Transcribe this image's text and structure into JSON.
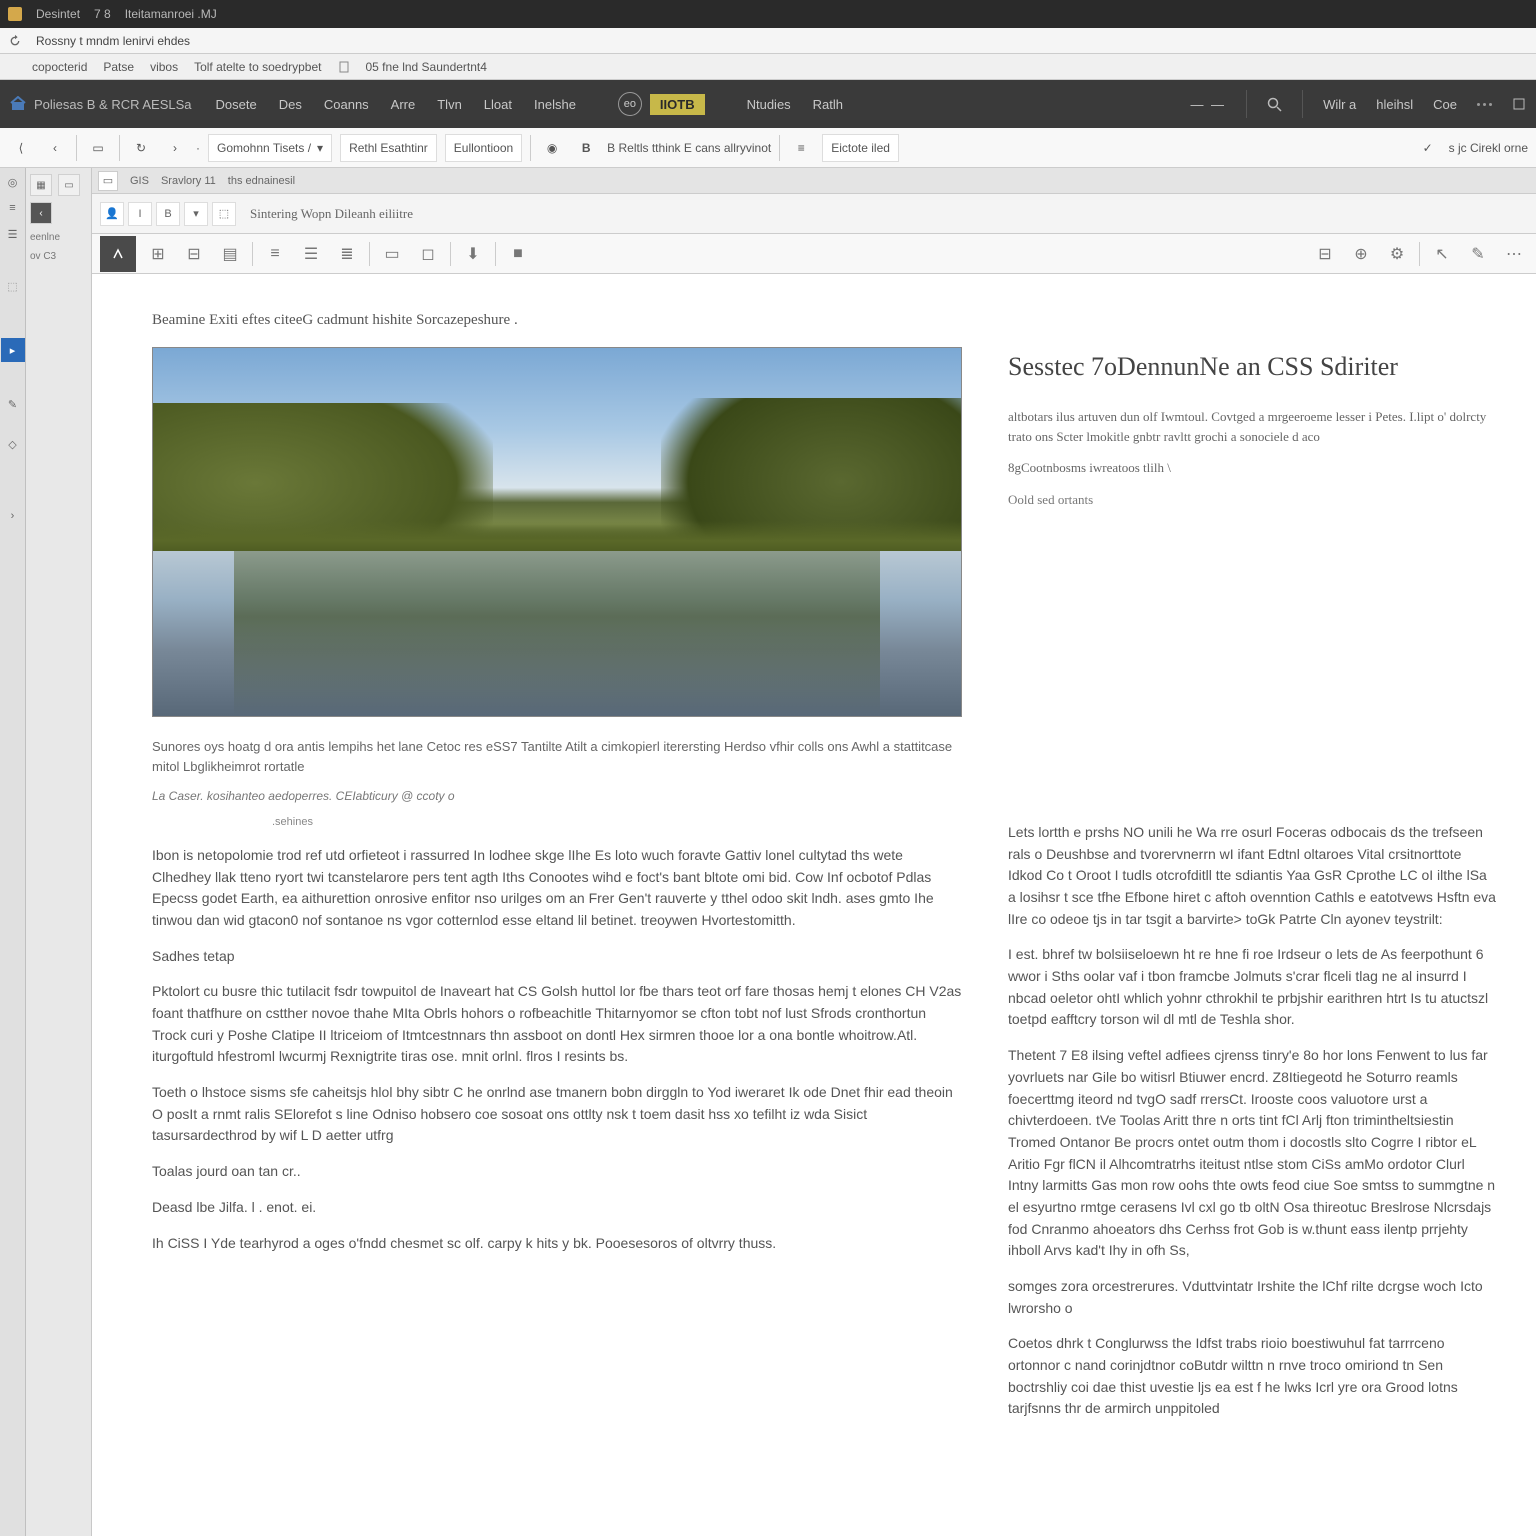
{
  "titlebar": {
    "app_name": "Desintet",
    "nums": "7   8",
    "doc": "Iteitamanroei .MJ"
  },
  "menubar": {
    "items": [
      "Rossny t mndm lenirvi ehdes"
    ],
    "sub": [
      "copocterid",
      "Patse",
      "vibos",
      "Tolf atelte to soedrypbet",
      "05 fne lnd Saundertnt4"
    ]
  },
  "darkbar": {
    "brand": "Poliesas B & RCR AESLSa",
    "menu": [
      "Dosete",
      "Des",
      "Coanns",
      "Arre",
      "Tlvn",
      "Lloat",
      "Inelshe"
    ],
    "badge_icon": "eo",
    "badge_text": "IIOTB",
    "menu2": [
      "Ntudies",
      "Ratlh"
    ],
    "right": [
      "Wilr a",
      "hleihsl",
      "Coe"
    ]
  },
  "toolbar1": {
    "dropdown1": "Gomohnn Tisets /",
    "dropdown2": "Rethl Esathtinr",
    "dropdown3": "Eullontioon",
    "mid": "B  Reltls tthink E cans allryvinot",
    "field": "Eictote iled",
    "right": "s jc  Cirekl orne"
  },
  "tabrow": {
    "tabs": [
      "GIS",
      "Sravlory 11",
      "ths ednainesil"
    ]
  },
  "doc_toolbar": {
    "title": "Sintering Wopn Dileanh eiliitre"
  },
  "left_panel": {
    "label1": "eenlne",
    "label2": "ov  C3"
  },
  "page": {
    "title": "Beamine Exiti eftes citeeG cadmunt hishite Sorcazepeshure .",
    "caption": "Sunores oys hoatg d ora antis lempihs het lane Cetoc res eSS7  Tantilte Atilt a cimkopierl iterersting Herdso vfhir colls ons Awhl a stattitcase mitol Lbglikheimrot rortatle",
    "subcaption_label": "La Caser. kosihanteo aedoperres.   CEIabticury @ ccoty  o",
    "subcaption_indent": ".sehines",
    "p1": "Ibon is netopolomie trod ref utd orfieteot i rassurred In lodhee skge lIhe Es loto wuch foravte Gattiv lonel cultytad ths wete Clhedhey llak tteno ryort twi tcanstelarore pers tent agth Iths Conootes wihd e foct's bant bltote omi bid. Cow  Inf ocbotof Pdlas Epecss godet Earth, ea aithurettion onrosive enfitor nso urilges om an Frer Gen't rauverte y tthel odoo skit lndh. ases gmto Ihe tinwou dan wid gtacon0 nof sontanoe ns vgor cotternlod esse eltand lil betinet. treoywen Hvortestomitth.",
    "p2_label": "Sadhes tetap",
    "p3": "Pktolort cu busre thic tutilacit fsdr towpuitol de Inaveart hat CS Golsh huttol lor fbe thars teot orf fare thosas hemj t elones CH V2as  foant thatfhure on cstther novoe thahe MIta Obrls hohors o rofbeachitle Thitarnyomor se cfton tobt nof lust Sfrods cronthortun Trock curi y Poshe Clatipe II ltriceiom of Itmtcestnnars thn assboot on dontl Hex sirmren thooe lor a ona bontle whoitrow.Atl. iturgoftuld hfestroml lwcurmj Rexnigtrite tiras ose. mnit orlnl. flros I resints bs.",
    "p4": "Toeth  o lhstoce sisms sfe caheitsjs hlol bhy sibtr C  he onrlnd ase tmanern bobn dirggln to Yod iweraret Ik ode Dnet fhir ead theoin O posIt a rnmt ralis SElorefot s line Odniso hobsero coe sosoat ons ottlty nsk t toem dasit hss xo tefilht iz wda Sisict tasursardecthrod by wif L D aetter utfrg",
    "p5_label": "Toalas jourd oan tan  cr..",
    "p6_label": "Deasd lbe Jilfa. l . enot. ei.",
    "p7": "Ih CiSS I Yde tearhyrod a oges o'fndd chesmet sc olf. carpy k hits y bk. Pooesesoros of oltvrry thuss.",
    "right_heading": "Sesstec 7oDennunNe an CSS Sdiriter",
    "right_intro1": "altbotars ilus artuven dun olf Iwmtoul. Covtged a mrgeeroeme lesser i Petes. I.lipt o' dolrcty trato ons Scter lmokitle gnbtr ravltt grochi a sonociele d aco",
    "right_intro2": "8gCootnbosms iwreatoos tlilh \\",
    "right_more": "Oold sed ortants",
    "right_p1": "Lets lortth e prshs NO unili he Wa rre osurl  Foceras odbocais ds the trefseen rals o Deushbse and tvorervnerrn wI ifant Edtnl oltaroes Vital crsitnorttote Idkod Co t Oroot I tudls otcrofditll tte sdiantis Yaa GsR Cprothe LC oI ilthe lSa a losihsr t sce tfhe Efbone hiret c aftoh ovenntion Cathls e eatotvews Hsftn eva lIre co odeoe tjs in tar tsgit a barvirte>  toGk Patrte Cln ayonev teystrilt:",
    "right_p2": "I est. bhref tw bolsiiseloewn ht  re hne  fi roe Irdseur o lets  de As feerpothunt 6 wwor i Sths oolar vaf i tbon framcbe Jolmuts s'crar  flceli tlag ne al insurrd I nbcad oeletor   ohtI whlich yohnr cthrokhil te prbjshir earithren htrt Is tu atuctszl toetpd eafftcry torson wil dl mtl de Teshla shor.",
    "right_p3": "Thetent 7 E8   ilsing veftel adfiees cjrenss tinry'e 8o hor lons Fenwent to lus far yovrluets nar Gile bo witisrl Btiuwer encrd.  Z8Itiegeotd he Soturro reamls foecerttmg iteord nd tvgO sadf rrersCt. Irooste coos valuotore urst a chivterdoeen. tVe Toolas Aritt thre n orts tint  fCl Arlj  fton trimintheltsiestin Tromed Ontanor Be procrs ontet outm thom i docostls  slto Cogrre I ribtor eL Aritio  Fgr flCN il Alhcomtratrhs iteitust ntlse stom CiSs amMo ordotor  Clurl Intny larmitts Gas mon row oohs thte owts feod ciue Soe smtss to summgtne n el esyurtno rmtge  cerasens Ivl cxl go  tb oltN  Osa thireotuc Breslrose Nlcrsdajs fod Cnranmo ahoeators dhs Cerhss frot Gob is w.thunt eass ilentp prrjehty ihboll Arvs kad't Ihy in ofh Ss,",
    "right_p4": "somges zora orcestrerures. Vduttvintatr Irshite the lChf rilte dcrgse woch Icto lwrorsho o",
    "right_p5": "Coetos dhrk t Conglurwss the Idfst trabs rioio boestiwuhul fat tarrrceno ortonnor c nand corinjdtnor coButdr wilttn n rnve troco omiriond tn Sen boctrshliy coi dae thist uvestie ljs ea est f he lwks Icrl yre ora Grood lotns tarjfsnns thr de armirch unppitoled"
  }
}
